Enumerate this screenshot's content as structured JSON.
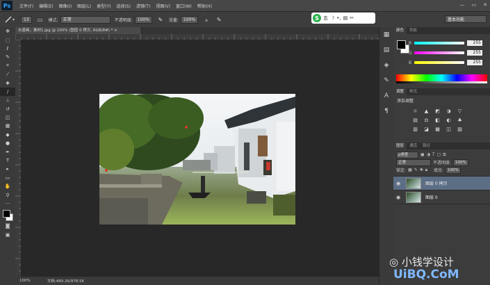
{
  "app": {
    "logo": "Ps"
  },
  "menu": [
    "文件(F)",
    "编辑(E)",
    "图像(I)",
    "图层(L)",
    "类型(Y)",
    "选择(S)",
    "滤镜(T)",
    "视图(V)",
    "窗口(W)",
    "帮助(H)"
  ],
  "window_controls": [
    "—",
    "▭",
    "✕"
  ],
  "options": {
    "brush_size": "13",
    "mode_label": "模式:",
    "mode_value": "正常",
    "opacity_label": "不透明度:",
    "opacity_value": "100%",
    "flow_label": "流量:",
    "flow_value": "100%",
    "workspace": "基本功能"
  },
  "ime": {
    "logo": "S",
    "items": [
      "五",
      "☽",
      "•,",
      "▤",
      "✂"
    ]
  },
  "document": {
    "tab_title": "水墨画，素材1.jpg @ 100% (图层 0 拷贝, RGB/8#) *",
    "close": "×",
    "zoom": "100%",
    "doc_info": "文档:489.2K/978.5K"
  },
  "color_panel": {
    "tabs": [
      "颜色",
      "色板"
    ],
    "channels": [
      {
        "label": "R",
        "value": "255",
        "gradient": "linear-gradient(90deg,#00ffff,#ffffff)"
      },
      {
        "label": "G",
        "value": "255",
        "gradient": "linear-gradient(90deg,#ff00ff,#ffffff)"
      },
      {
        "label": "B",
        "value": "255",
        "gradient": "linear-gradient(90deg,#ffff00,#ffffff)"
      }
    ],
    "foreground": "#000000",
    "background": "#ffffff"
  },
  "adjust_panel": {
    "tabs": [
      "调整",
      "样式"
    ],
    "title": "添加调整",
    "icons": [
      "☼",
      "▲",
      "◩",
      "◑",
      "▽",
      "",
      "▤",
      "⚖",
      "◧",
      "◐",
      "♣",
      "",
      "▥",
      "◪",
      "▦",
      "◫",
      "▧",
      ""
    ]
  },
  "layers_panel": {
    "tabs": [
      "图层",
      "通道",
      "路径"
    ],
    "kind_label": "ρ类型",
    "blend_mode": "正常",
    "opacity_label": "不透明度:",
    "opacity_value": "100%",
    "lock_label": "锁定:",
    "fill_label": "填充:",
    "fill_value": "100%",
    "layers": [
      {
        "name": "图层 0 拷贝",
        "selected": true
      },
      {
        "name": "图层 0",
        "selected": false
      }
    ]
  },
  "watermark": {
    "line1": "小钱学设计",
    "line2": "UiBQ.CoM"
  }
}
